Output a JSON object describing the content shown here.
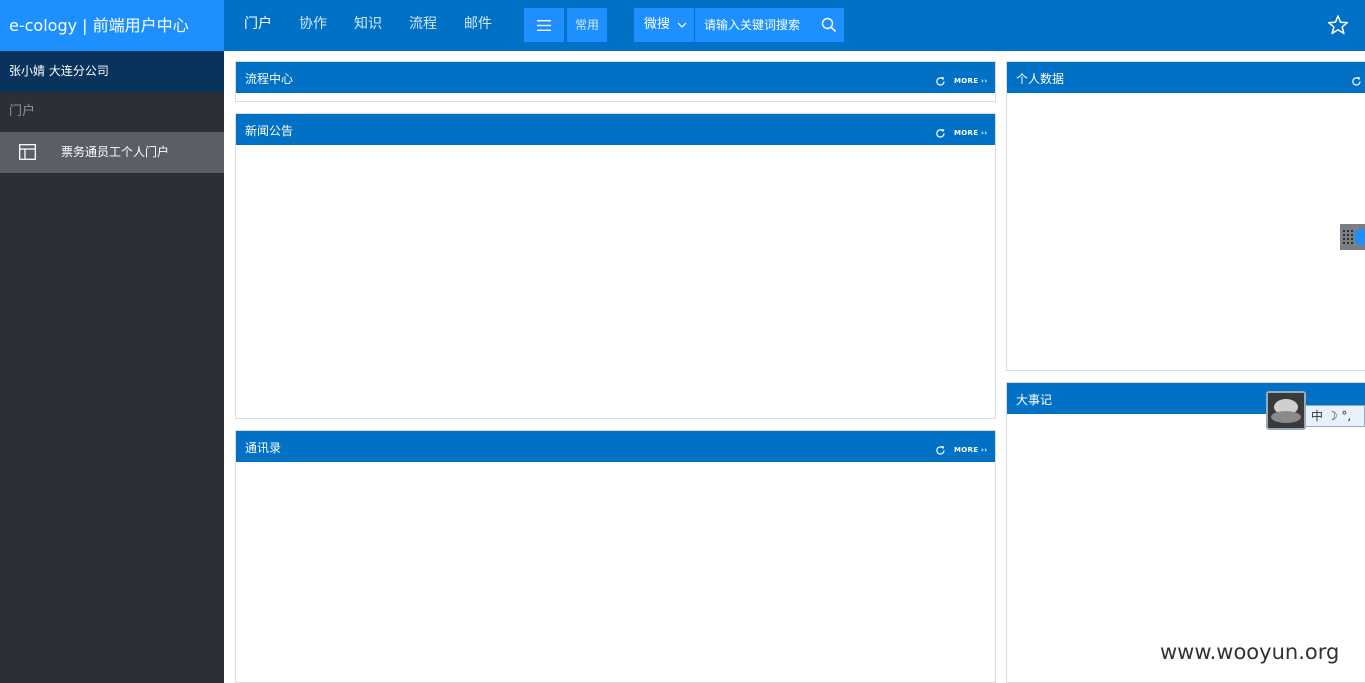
{
  "brand": {
    "title": "e-cology | 前端用户中心"
  },
  "nav": {
    "items": [
      {
        "label": "门户",
        "active": true
      },
      {
        "label": "协作",
        "active": false
      },
      {
        "label": "知识",
        "active": false
      },
      {
        "label": "流程",
        "active": false
      },
      {
        "label": "邮件",
        "active": false
      }
    ],
    "common_label": "常用",
    "menu_icon": "hamburger-icon"
  },
  "search": {
    "type_label": "微搜",
    "placeholder": "请输入关键词搜索"
  },
  "sidebar": {
    "user": "张小婧  大连分公司",
    "section": "门户",
    "items": [
      {
        "label": "票务通员工个人门户",
        "icon": "layout-icon"
      }
    ]
  },
  "panels": {
    "workflow": {
      "title": "流程中心",
      "more": "MORE"
    },
    "news": {
      "title": "新闻公告",
      "more": "MORE"
    },
    "contacts": {
      "title": "通讯录",
      "more": "MORE"
    },
    "personal": {
      "title": "个人数据"
    },
    "events": {
      "title": "大事记"
    }
  },
  "ime": {
    "label": "中 ☽ °,"
  },
  "watermark": "www.wooyun.org",
  "colors": {
    "primary": "#0071c5",
    "brand_bg": "#1e8fff",
    "sidebar_bg": "#2b2f36",
    "user_bar_bg": "#07335c",
    "active_item_bg": "#5a5e66"
  }
}
